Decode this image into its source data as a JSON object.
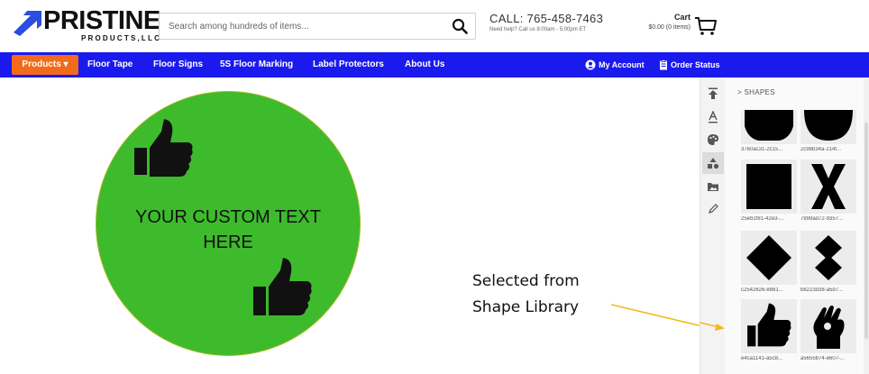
{
  "header": {
    "logo": {
      "name": "PRISTINE",
      "sub": "PRODUCTS,LLC"
    },
    "search": {
      "placeholder": "Search among hundreds of items..."
    },
    "call": {
      "main": "CALL: 765-458-7463",
      "sub": "Need help? Call us 8:00am - 5:00pm ET"
    },
    "cart": {
      "title": "Cart",
      "sub": "$0.00 (0 items)"
    }
  },
  "nav": {
    "products": "Products ▾",
    "links": [
      "Floor Tape",
      "Floor Signs",
      "5S Floor Marking",
      "Label Protectors",
      "About Us"
    ],
    "account": "My Account",
    "order_status": "Order Status"
  },
  "canvas": {
    "custom_text_line1": "YOUR CUSTOM TEXT",
    "custom_text_line2": "HERE",
    "fill_color": "#3dbb2c",
    "icon": "thumbs-up-icon"
  },
  "annotation": {
    "line1": "Selected from",
    "line2": "Shape Library",
    "arrow_color": "#f5b916"
  },
  "tools": [
    "upload-icon",
    "text-icon",
    "palette-icon",
    "shapes-icon",
    "images-icon",
    "pencil-icon"
  ],
  "panel": {
    "title": ">  SHAPES",
    "shapes": [
      {
        "label": "3760ac31-2c15...",
        "icon": "flat-bottom-shape-icon"
      },
      {
        "label": "2c98b34a-214f...",
        "icon": "semicircle-icon"
      },
      {
        "label": "25eb1f81-42e3-...",
        "icon": "square-icon"
      },
      {
        "label": "7899ad72-9357...",
        "icon": "x-mark-icon"
      },
      {
        "label": "c2542626-8881...",
        "icon": "diamond-icon"
      },
      {
        "label": "b8223d38-a5d7...",
        "icon": "double-diamond-icon"
      },
      {
        "label": "e4ca1141-a5c8...",
        "icon": "thumbs-up-icon"
      },
      {
        "label": "a5655b74-e607-...",
        "icon": "ok-hand-icon"
      }
    ]
  }
}
